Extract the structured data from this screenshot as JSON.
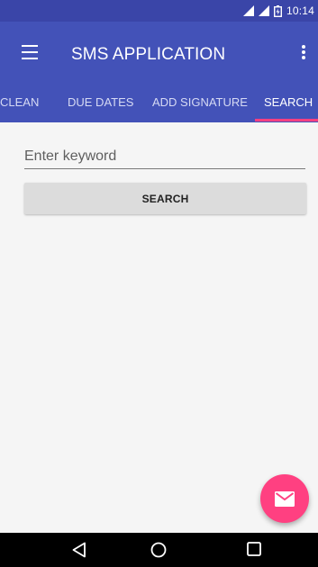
{
  "status_bar": {
    "time": "10:14",
    "icons": [
      "signal-icon",
      "wifi-signal-icon",
      "battery-icon"
    ],
    "color": "#3a45a8"
  },
  "app_bar": {
    "title": "SMS APPLICATION",
    "menu_icon": "hamburger-menu-icon",
    "overflow_icon": "more-vert-icon",
    "color": "#4352b8"
  },
  "tabs": {
    "items": [
      {
        "label": "CLEAN"
      },
      {
        "label": "DUE DATES"
      },
      {
        "label": "ADD SIGNATURE"
      },
      {
        "label": "SEARCH"
      }
    ],
    "active": "SEARCH",
    "indicator_color": "#ff4081"
  },
  "search": {
    "placeholder": "Enter keyword",
    "value": "",
    "button_label": "SEARCH"
  },
  "fab": {
    "icon": "email-icon",
    "color": "#ff4081"
  },
  "nav_bar": {
    "icons": [
      "back-icon",
      "home-icon",
      "recents-icon"
    ]
  }
}
